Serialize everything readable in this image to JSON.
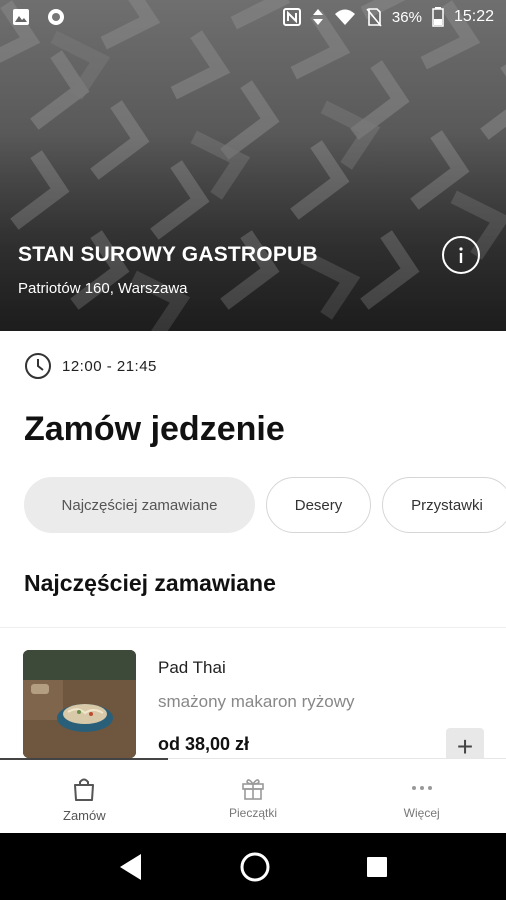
{
  "status_bar": {
    "battery": "36%",
    "time": "15:22",
    "icons": [
      "image-icon",
      "circle-icon",
      "nfc-icon",
      "data-arrows-icon",
      "wifi-icon",
      "no-sim-icon",
      "battery-icon"
    ]
  },
  "venue": {
    "name": "STAN SUROWY GASTROPUB",
    "address": "Patriotów 160, Warszawa",
    "info_icon": "info-icon"
  },
  "hours": {
    "icon": "clock-icon",
    "text": "12:00 - 21:45"
  },
  "main": {
    "title": "Zamów jedzenie",
    "chips": [
      {
        "label": "Najczęściej zamawiane",
        "active": true
      },
      {
        "label": "Desery",
        "active": false
      },
      {
        "label": "Przystawki",
        "active": false
      }
    ],
    "section_title": "Najczęściej zamawiane",
    "items": [
      {
        "name": "Pad Thai",
        "description": "smażony makaron ryżowy",
        "price": "od 38,00 zł",
        "add_label": "+"
      }
    ]
  },
  "bottom_nav": {
    "items": [
      {
        "label": "Zamów",
        "icon": "shopping-bag-icon",
        "active": true
      },
      {
        "label": "Pieczątki",
        "icon": "gift-icon",
        "active": false
      },
      {
        "label": "Więcej",
        "icon": "more-dots-icon",
        "active": false
      }
    ]
  },
  "system_nav": {
    "icons": [
      "back-icon",
      "home-icon",
      "recents-icon"
    ]
  }
}
